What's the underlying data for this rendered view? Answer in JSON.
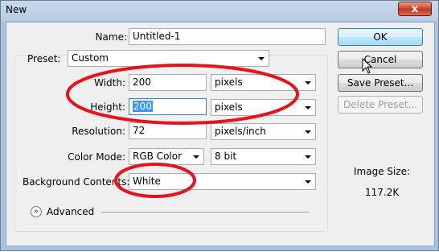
{
  "window": {
    "title": "New",
    "close_label": "x"
  },
  "form": {
    "name_label": "Name:",
    "name_value": "Untitled-1",
    "preset_label": "Preset:",
    "preset_value": "Custom",
    "width_label": "Width:",
    "width_value": "200",
    "width_unit": "pixels",
    "height_label": "Height:",
    "height_value": "200",
    "height_unit": "pixels",
    "resolution_label": "Resolution:",
    "resolution_value": "72",
    "resolution_unit": "pixels/inch",
    "color_mode_label": "Color Mode:",
    "color_mode_value": "RGB Color",
    "bit_depth_value": "8 bit",
    "bg_label": "Background Contents:",
    "bg_value": "White",
    "advanced_label": "Advanced"
  },
  "buttons": {
    "ok": "OK",
    "cancel": "Cancel",
    "save_preset": "Save Preset...",
    "delete_preset": "Delete Preset..."
  },
  "image_size": {
    "label": "Image Size:",
    "value": "117.2K"
  },
  "colors": {
    "annotation_red": "#e8121a",
    "highlight": "#3399ff"
  }
}
